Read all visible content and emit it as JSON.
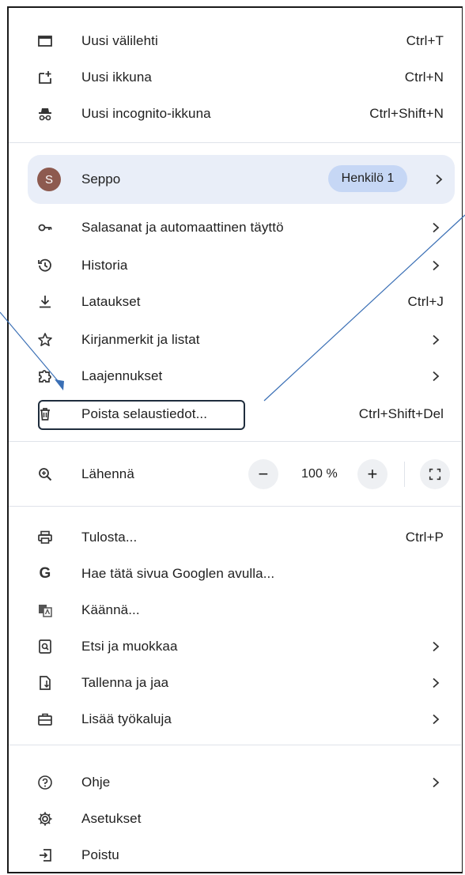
{
  "menu": {
    "items_top": [
      {
        "label": "Uusi välilehti",
        "shortcut": "Ctrl+T",
        "icon": "new-tab-icon"
      },
      {
        "label": "Uusi ikkuna",
        "shortcut": "Ctrl+N",
        "icon": "new-window-icon"
      },
      {
        "label": "Uusi incognito-ikkuna",
        "shortcut": "Ctrl+Shift+N",
        "icon": "incognito-icon"
      }
    ],
    "profile": {
      "initial": "S",
      "name": "Seppo",
      "badge": "Henkilö 1"
    },
    "items_mid": [
      {
        "label": "Salasanat ja automaattinen täyttö",
        "icon": "key-icon"
      },
      {
        "label": "Historia",
        "icon": "history-icon"
      },
      {
        "label": "Lataukset",
        "shortcut": "Ctrl+J",
        "icon": "download-icon"
      },
      {
        "label": "Kirjanmerkit ja listat",
        "icon": "star-icon"
      },
      {
        "label": "Laajennukset",
        "icon": "extension-icon"
      },
      {
        "label": "Poista selaustiedot...",
        "shortcut": "Ctrl+Shift+Del",
        "icon": "trash-icon"
      }
    ],
    "zoom": {
      "label": "Lähennä",
      "minus": "−",
      "value": "100 %",
      "plus": "+",
      "icon": "zoom-icon"
    },
    "items_tools": [
      {
        "label": "Tulosta...",
        "shortcut": "Ctrl+P",
        "icon": "print-icon"
      },
      {
        "label": "Hae tätä sivua Googlen avulla...",
        "icon": "google-icon"
      },
      {
        "label": "Käännä...",
        "icon": "translate-icon"
      },
      {
        "label": "Etsi ja muokkaa",
        "icon": "find-icon"
      },
      {
        "label": "Tallenna ja jaa",
        "icon": "save-share-icon"
      },
      {
        "label": "Lisää työkaluja",
        "icon": "toolbox-icon"
      }
    ],
    "items_bottom": [
      {
        "label": "Ohje",
        "icon": "help-icon"
      },
      {
        "label": "Asetukset",
        "icon": "settings-gear-icon"
      },
      {
        "label": "Poistu",
        "icon": "exit-icon"
      }
    ]
  },
  "colors": {
    "profile_bg": "#e9eef8",
    "badge_bg": "#c6d7f5",
    "avatar": "#8d5a4f",
    "arrow": "#3a6fb5"
  }
}
